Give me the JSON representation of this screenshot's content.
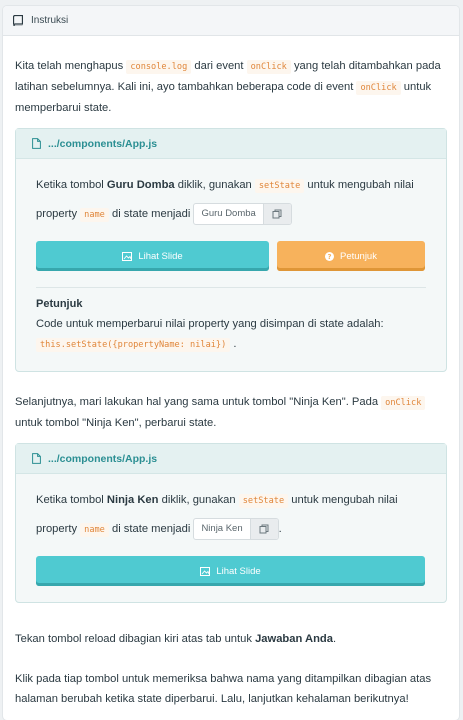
{
  "header": {
    "title": "Instruksi",
    "icon": "book-icon"
  },
  "intro": {
    "t1": "Kita telah menghapus",
    "c1": "console.log",
    "t2": "dari event",
    "c2": "onClick",
    "t3": "yang telah ditambahkan pada latihan sebelumnya. Kali ini, ayo tambahkan beberapa code di event",
    "c3": "onClick",
    "t4": "untuk memperbarui state."
  },
  "box1": {
    "file": ".../components/App.js",
    "t1": "Ketika tombol",
    "bold": "Guru Domba",
    "t2": "diklik, gunakan",
    "c1": "setState",
    "t3": "untuk mengubah nilai property",
    "c2": "name",
    "t4": "di state menjadi",
    "value": "Guru Domba",
    "slide_label": "Lihat Slide",
    "hint_label": "Petunjuk",
    "hint_title": "Petunjuk",
    "hint_text": "Code untuk memperbarui nilai property yang disimpan di state adalah:",
    "hint_code": "this.setState({propertyName: nilai})",
    "hint_end": "."
  },
  "middle": {
    "t1": "Selanjutnya, mari lakukan hal yang sama untuk tombol \"Ninja Ken\". Pada",
    "c1": "onClick",
    "t2": "untuk tombol \"Ninja Ken\", perbarui state."
  },
  "box2": {
    "file": ".../components/App.js",
    "t1": "Ketika tombol",
    "bold": "Ninja Ken",
    "t2": "diklik, gunakan",
    "c1": "setState",
    "t3": "untuk mengubah nilai property",
    "c2": "name",
    "t4": "di state menjadi",
    "value": "Ninja Ken",
    "end": ".",
    "slide_label": "Lihat Slide"
  },
  "footer": {
    "t1": "Tekan tombol reload dibagian kiri atas tab untuk",
    "bold": "Jawaban Anda",
    "end": ".",
    "p2": "Klik pada tiap tombol untuk memeriksa bahwa nama yang ditampilkan dibagian atas halaman berubah ketika state diperbarui. Lalu, lanjutkan kehalaman berikutnya!"
  },
  "colors": {
    "accent": "#4fcad1",
    "hint": "#f7b25c",
    "code": "#e0863a"
  }
}
